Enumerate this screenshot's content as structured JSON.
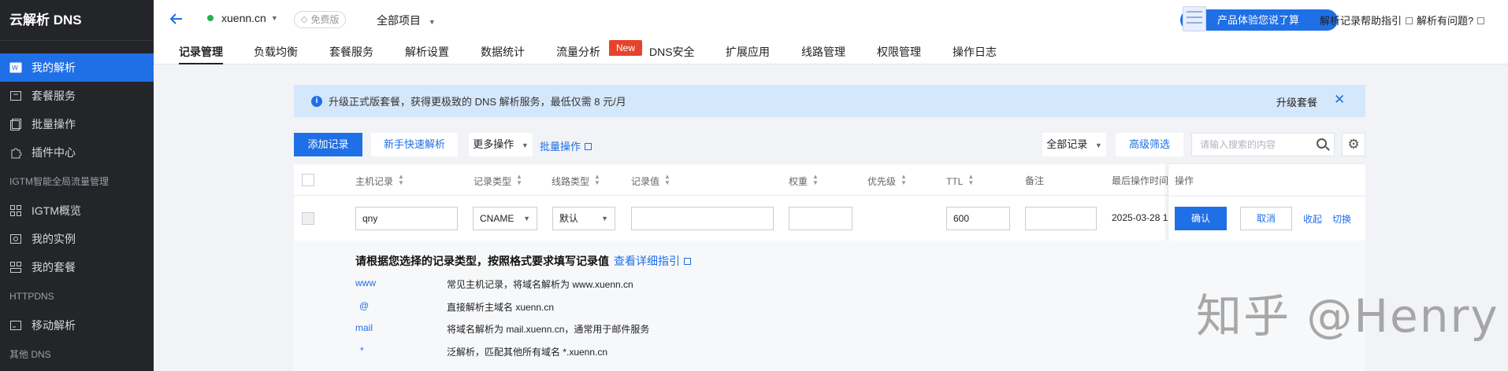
{
  "sidebar": {
    "brand": "云解析 DNS",
    "items": [
      {
        "label": "我的解析",
        "icon": "dns-icon",
        "active": true
      },
      {
        "label": "套餐服务",
        "icon": "package-icon"
      },
      {
        "label": "批量操作",
        "icon": "batch-icon"
      },
      {
        "label": "插件中心",
        "icon": "plugin-icon"
      }
    ],
    "section_igtm": "IGTM智能全局流量管理",
    "igtm_items": [
      {
        "label": "IGTM概览",
        "icon": "grid-icon"
      },
      {
        "label": "我的实例",
        "icon": "instance-icon"
      },
      {
        "label": "我的套餐",
        "icon": "plan-icon"
      }
    ],
    "section_httpdns": "HTTPDNS",
    "httpdns_items": [
      {
        "label": "移动解析",
        "icon": "mobile-icon"
      }
    ],
    "section_other": "其他 DNS"
  },
  "header": {
    "domain": "xuenn.cn",
    "free_badge": "免费版",
    "project": "全部项目",
    "experience_btn": "产品体验您说了算",
    "help_link": "解析记录帮助指引",
    "question_link": "解析有问题?"
  },
  "tabs": [
    "记录管理",
    "负载均衡",
    "套餐服务",
    "解析设置",
    "数据统计",
    "流量分析",
    "DNS安全",
    "扩展应用",
    "线路管理",
    "权限管理",
    "操作日志"
  ],
  "new_badge": "New",
  "notice": {
    "text": "升级正式版套餐，获得更极致的 DNS 解析服务，最低仅需 8 元/月",
    "upgrade": "升级套餐"
  },
  "toolbar": {
    "add_record": "添加记录",
    "quick_setup": "新手快速解析",
    "more_actions": "更多操作",
    "batch_link": "批量操作",
    "filter": "全部记录",
    "advanced": "高级筛选",
    "search_placeholder": "请输入搜索的内容"
  },
  "table": {
    "headers": {
      "host": "主机记录",
      "type": "记录类型",
      "line": "线路类型",
      "value": "记录值",
      "weight": "权重",
      "priority": "优先级",
      "ttl": "TTL",
      "remark": "备注",
      "last_op": "最后操作时间",
      "actions": "操作"
    },
    "row": {
      "host": "qny",
      "type": "CNAME",
      "line": "默认",
      "value": "",
      "weight": "",
      "ttl": "600",
      "remark": "",
      "last_op": "2025-03-28 1"
    },
    "actions": {
      "confirm": "确认",
      "cancel": "取消",
      "collapse": "收起",
      "switch": "切换"
    }
  },
  "hint": {
    "title": "请根据您选择的记录类型，按照格式要求填写记录值",
    "guide_link": "查看详细指引",
    "rows": [
      {
        "key": "www",
        "desc": "常见主机记录，将域名解析为 www.xuenn.cn"
      },
      {
        "key": "@",
        "desc": "直接解析主域名 xuenn.cn"
      },
      {
        "key": "mail",
        "desc": "将域名解析为 mail.xuenn.cn，通常用于邮件服务"
      },
      {
        "key": "*",
        "desc": "泛解析，匹配其他所有域名 *.xuenn.cn"
      }
    ]
  },
  "watermark": "知乎 @Henry"
}
